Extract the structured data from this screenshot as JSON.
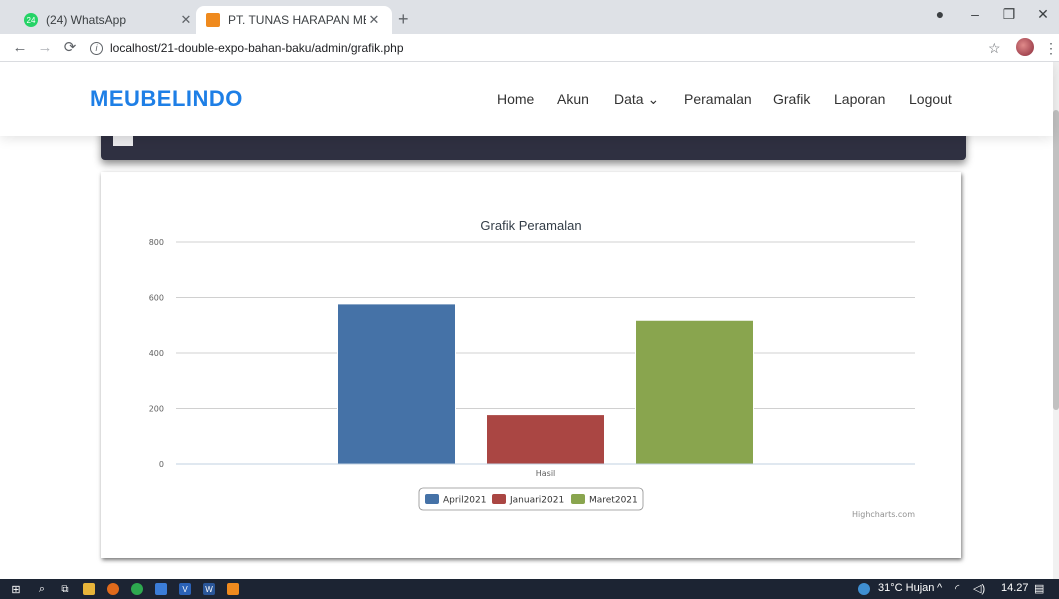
{
  "browser": {
    "tabs": [
      {
        "title": "(24) WhatsApp",
        "favicon_badge": "24",
        "active": false
      },
      {
        "title": "PT. TUNAS HARAPAN MEUBELIN",
        "active": true
      }
    ],
    "url": "localhost/21-double-expo-bahan-baku/admin/grafik.php"
  },
  "site": {
    "brand": "MEUBELINDO",
    "menu": [
      {
        "label": "Home"
      },
      {
        "label": "Akun"
      },
      {
        "label": "Data ⌄"
      },
      {
        "label": "Peramalan"
      },
      {
        "label": "Grafik"
      },
      {
        "label": "Laporan"
      },
      {
        "label": "Logout"
      }
    ],
    "colors": {
      "brand": "#1e7fe6",
      "banner": "#2f3041"
    }
  },
  "chart_data": {
    "type": "bar",
    "title": "Grafik Peramalan",
    "categories": [
      "Hasil"
    ],
    "series": [
      {
        "name": "April2021",
        "values": [
          577
        ],
        "color": "#4572a7"
      },
      {
        "name": "Januari2021",
        "values": [
          178
        ],
        "color": "#aa4643"
      },
      {
        "name": "Maret2021",
        "values": [
          518
        ],
        "color": "#89a54e"
      }
    ],
    "ylim": [
      0,
      800
    ],
    "yticks": [
      "0",
      "200",
      "400",
      "600",
      "800"
    ],
    "grid": true,
    "legend": "bottom",
    "credits": "Highcharts.com"
  },
  "taskbar": {
    "weather": "31°C  Hujan",
    "time": "14.27"
  }
}
